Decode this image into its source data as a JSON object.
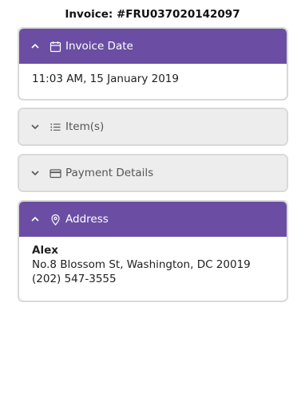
{
  "invoice_title": "Invoice: #FRU037020142097",
  "accent_color": "#6b4ea3",
  "panels": {
    "invoice_date": {
      "header": "Invoice Date",
      "icon": "calendar-icon",
      "expanded": true,
      "value": "11:03 AM, 15 January 2019"
    },
    "items": {
      "header": "Item(s)",
      "icon": "list-icon",
      "expanded": false
    },
    "payment": {
      "header": "Payment Details",
      "icon": "credit-card-icon",
      "expanded": false
    },
    "address": {
      "header": "Address",
      "icon": "location-pin-icon",
      "expanded": true,
      "name": "Alex",
      "street": "No.8 Blossom St, Washington, DC 20019",
      "phone": "(202) 547-3555"
    }
  }
}
